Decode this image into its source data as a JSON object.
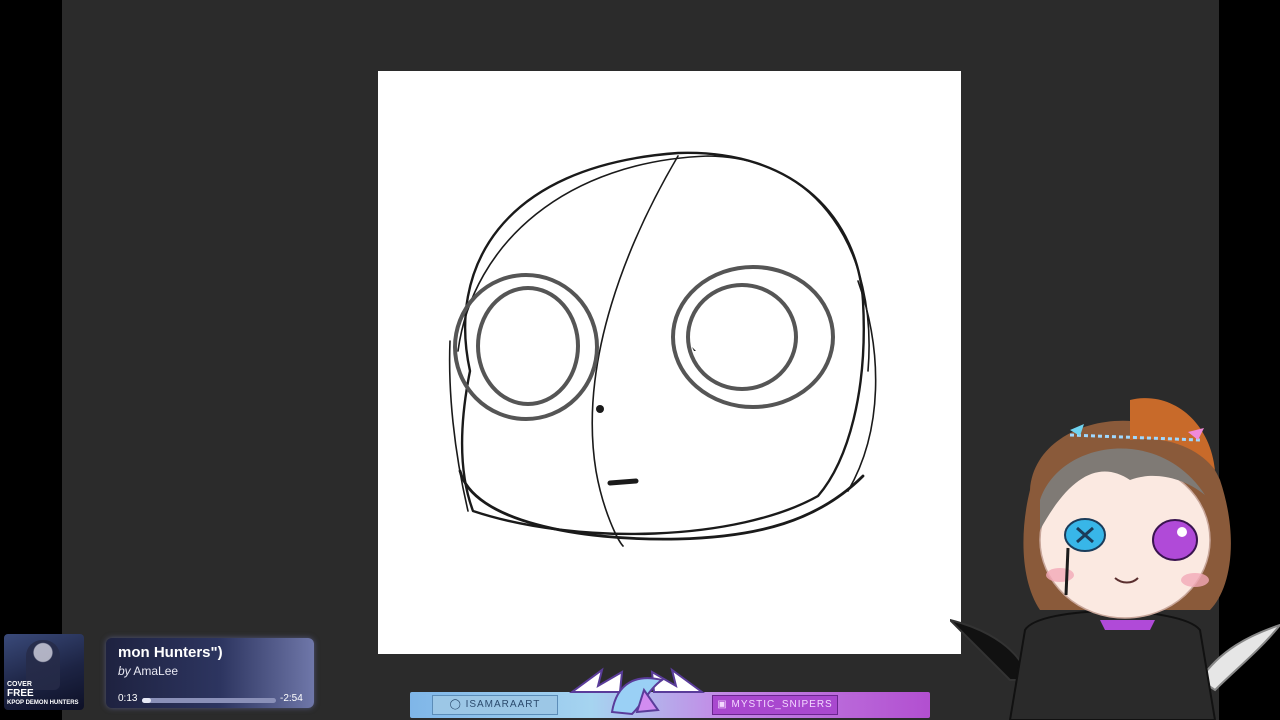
{
  "music": {
    "title": "mon Hunters\")",
    "by_label": "by",
    "artist": "AmaLee",
    "elapsed": "0:13",
    "remaining": "-2:54",
    "progress": 0.07,
    "cover_label_top": "COVER",
    "cover_label_mid": "FREE",
    "cover_label_bottom": "KPOP DEMON HUNTERS"
  },
  "banner": {
    "handle_left": "ISAMARAART",
    "handle_right": "MYSTIC_SNIPERS",
    "left_icon": "user-icon",
    "right_icon": "trophy-icon"
  },
  "colors": {
    "workspace": "#2b2b2b",
    "canvas": "#ffffff",
    "stroke": "#1a1a1a",
    "banner_blue": "#9cc7e6",
    "banner_purple": "#a948cf"
  }
}
